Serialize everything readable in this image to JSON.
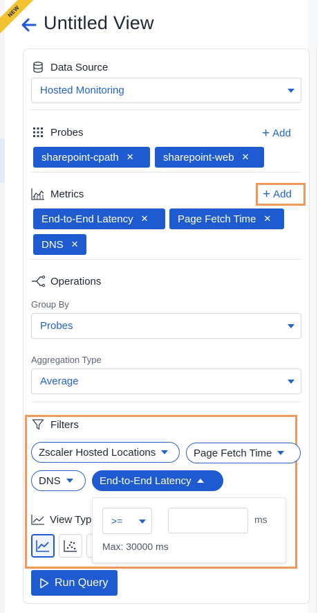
{
  "badge": {
    "label": "NEW"
  },
  "header": {
    "title": "Untitled View"
  },
  "data_source": {
    "label": "Data Source",
    "selected": "Hosted Monitoring"
  },
  "probes": {
    "label": "Probes",
    "add_label": "Add",
    "items": [
      "sharepoint-cpath",
      "sharepoint-web"
    ]
  },
  "metrics": {
    "label": "Metrics",
    "add_label": "Add",
    "items": [
      "End-to-End Latency",
      "Page Fetch Time",
      "DNS"
    ]
  },
  "operations": {
    "label": "Operations",
    "group_by_label": "Group By",
    "group_by_value": "Probes",
    "aggregation_label": "Aggregation Type",
    "aggregation_value": "Average"
  },
  "filters": {
    "label": "Filters",
    "items": [
      "Zscaler Hosted Locations",
      "Page Fetch Time",
      "DNS",
      "End-to-End Latency"
    ],
    "active_index": 3,
    "popover": {
      "operator": ">=",
      "value": "",
      "unit": "ms",
      "max_note": "Max: 30000 ms"
    }
  },
  "view_type": {
    "label": "View Typ"
  },
  "actions": {
    "run_label": "Run Query"
  },
  "colors": {
    "accent": "#1e5bd0",
    "link": "#2563c9",
    "highlight": "#f0995a",
    "badge": "#f2c230"
  },
  "icons": [
    "arrow-left-icon",
    "database-icon",
    "probes-grid-icon",
    "metrics-chart-icon",
    "operations-branch-icon",
    "filter-funnel-icon",
    "line-chart-icon",
    "scatter-chart-icon",
    "play-icon",
    "close-icon",
    "chevron-down-icon",
    "chevron-up-icon",
    "plus-icon"
  ]
}
